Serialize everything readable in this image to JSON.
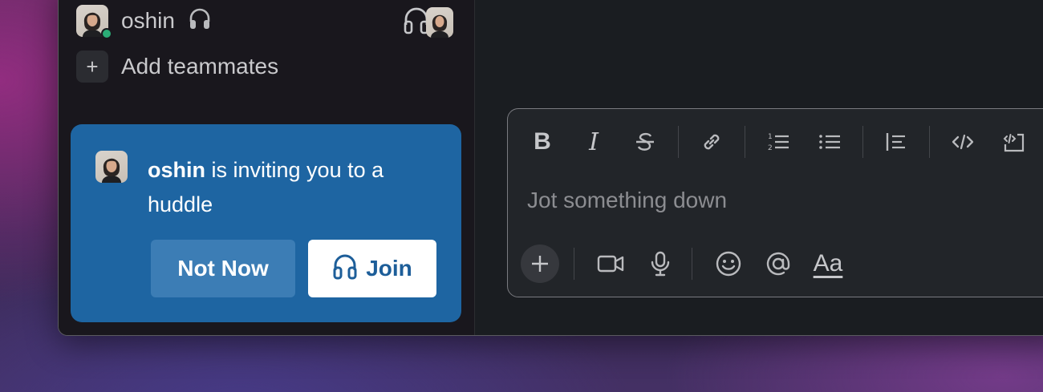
{
  "sidebar": {
    "dm_user": {
      "name": "oshin",
      "status": "online",
      "status_color": "#2bac76"
    },
    "add_teammates_label": "Add teammates",
    "add_icon_glyph": "+"
  },
  "invite": {
    "user": "oshin",
    "message": " is inviting you to a huddle",
    "not_now_label": "Not Now",
    "join_label": "Join",
    "card_color": "#1e65a2"
  },
  "composer": {
    "placeholder": "Jot something down",
    "toolbar": [
      "bold-icon",
      "italic-icon",
      "strikethrough-icon",
      "link-icon",
      "ordered-list-icon",
      "bulleted-list-icon",
      "blockquote-icon",
      "code-icon",
      "code-block-icon"
    ],
    "bold_glyph": "B",
    "italic_glyph": "I",
    "format_label": "Aa"
  }
}
